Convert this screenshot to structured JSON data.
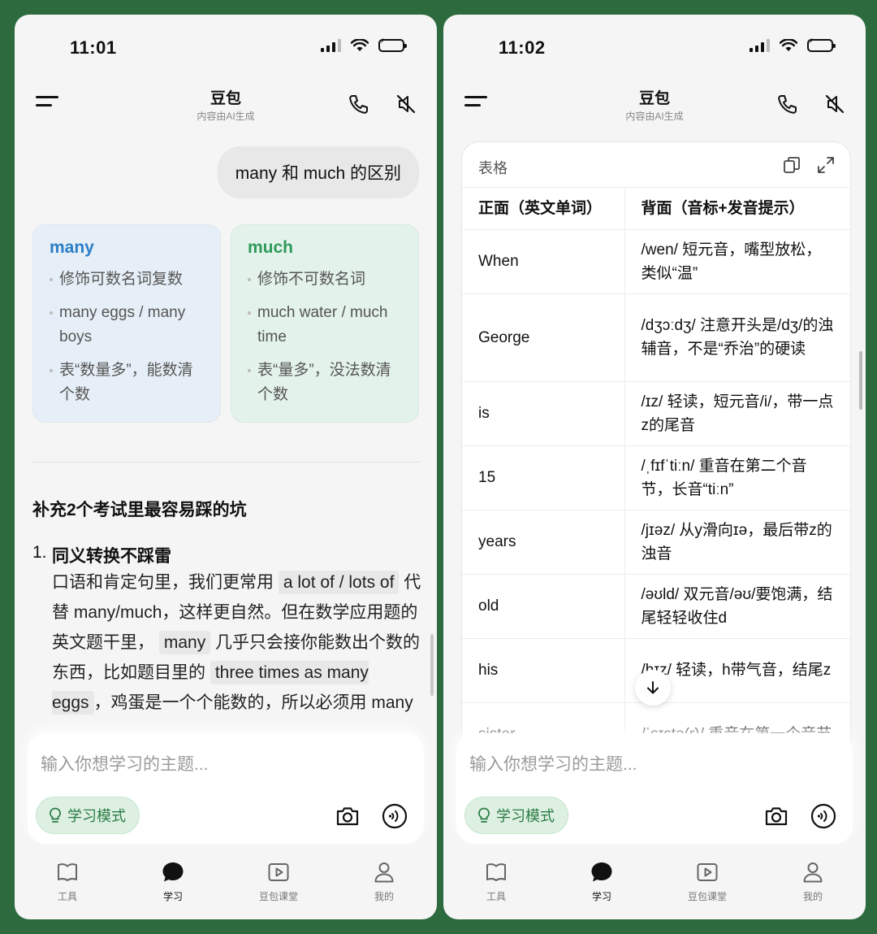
{
  "left": {
    "status": {
      "time": "11:01"
    },
    "header": {
      "title": "豆包",
      "subtitle": "内容由AI生成"
    },
    "user_message": "many 和 much 的区别",
    "cards": [
      {
        "title": "many",
        "items": [
          "修饰可数名词复数",
          "many eggs / many boys",
          "表“数量多”，能数清个数"
        ]
      },
      {
        "title": "much",
        "items": [
          "修饰不可数名词",
          "much water / much time",
          "表“量多”，没法数清个数"
        ]
      }
    ],
    "section_title": "补充2个考试里最容易踩的坑",
    "point": {
      "number": "1.",
      "title": "同义转换不踩雷",
      "body_1": "口语和肯定句里，我们更常用",
      "hl_1": "a lot of / lots of",
      "body_2": "代替 many/much，这样更自然。但在数学应用题的英文题干里，",
      "hl_2": "many",
      "body_3": "几乎只会接你能数出个数的东西，比如题目里的",
      "hl_3": "three times as many eggs",
      "body_4": "，鸡蛋是一个个能数的，所以必须用 many"
    },
    "input": {
      "placeholder": "输入你想学习的主题...",
      "study_mode": "学习模式"
    }
  },
  "right": {
    "status": {
      "time": "11:02"
    },
    "header": {
      "title": "豆包",
      "subtitle": "内容由AI生成"
    },
    "table": {
      "label": "表格",
      "headers": [
        "正面（英文单词）",
        "背面（音标+发音提示）"
      ],
      "rows": [
        [
          "When",
          "/wen/ 短元音，嘴型放松，类似“温”"
        ],
        [
          "George",
          "/dʒɔːdʒ/ 注意开头是/dʒ/的浊辅音，不是“乔治”的硬读"
        ],
        [
          "is",
          "/ɪz/ 轻读，短元音/i/，带一点z的尾音"
        ],
        [
          "15",
          "/ˌfɪfˈtiːn/ 重音在第二个音节，长音“tiːn”"
        ],
        [
          "years",
          "/jɪəz/ 从y滑向ɪə，最后带z的浊音"
        ],
        [
          "old",
          "/əʊld/ 双元音/əʊ/要饱满，结尾轻轻收住d"
        ],
        [
          "his",
          "/hɪz/ 轻读，h带气音，结尾z"
        ],
        [
          "sister",
          "/ˈsɪstə(r)/ 重音在第一个音节"
        ]
      ]
    },
    "input": {
      "placeholder": "输入你想学习的主题...",
      "study_mode": "学习模式"
    }
  },
  "tabs": [
    "工具",
    "学习",
    "豆包课堂",
    "我的"
  ],
  "colors": {
    "background": "#2d6b3e",
    "many": "#2b7fc8",
    "much": "#2e9a5a",
    "study_mode": "#2a7a44"
  }
}
